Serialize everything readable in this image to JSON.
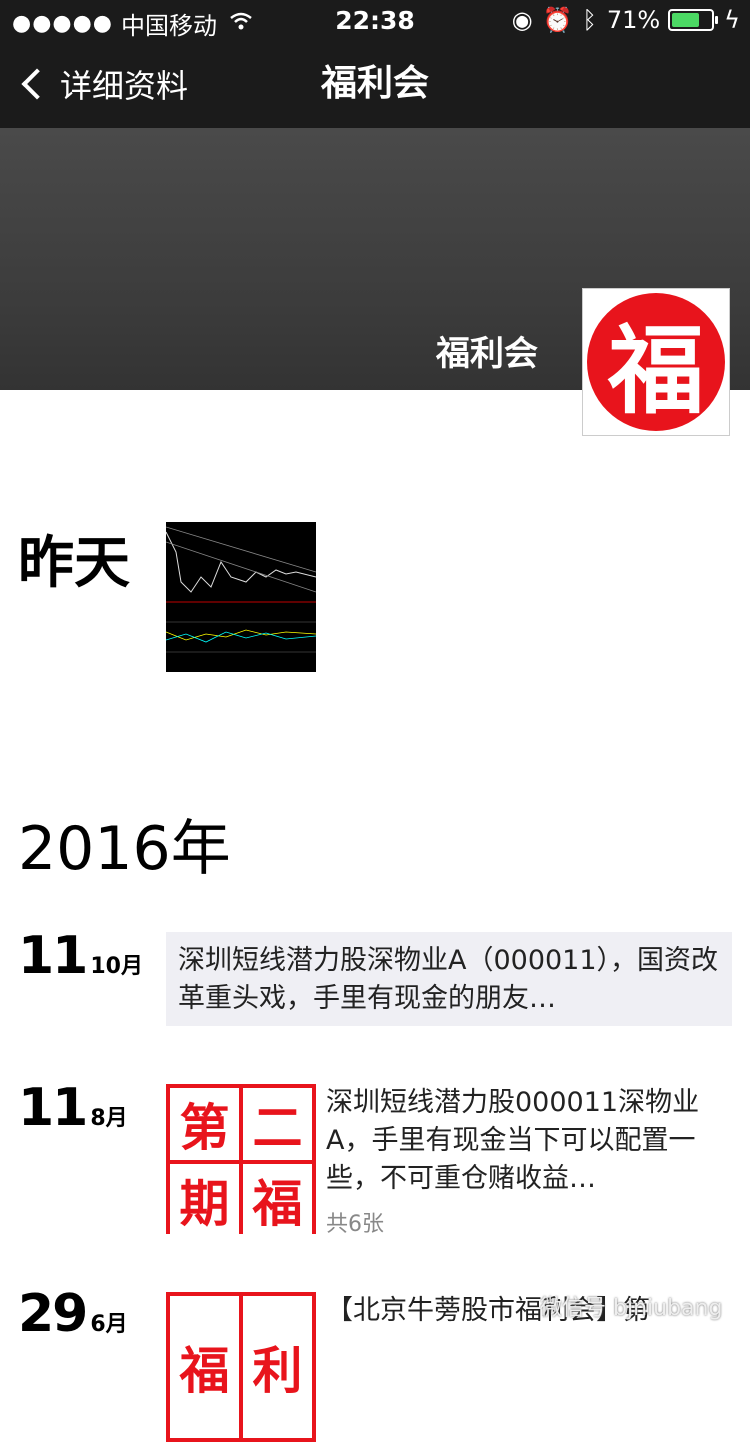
{
  "status_bar": {
    "signal": "●●●●●",
    "carrier": "中国移动",
    "time": "22:38",
    "battery": "71%",
    "battery_level": 0.71
  },
  "nav": {
    "back_label": "详细资料",
    "title": "福利会"
  },
  "profile": {
    "name": "福利会",
    "avatar_char": "福"
  },
  "timeline": {
    "day_label": "昨天",
    "year_label": "2016年",
    "posts": [
      {
        "day": "11",
        "month": "10月",
        "text": "深圳短线潜力股深物业A（000011），国资改革重头戏，手里有现金的朋友…"
      },
      {
        "day": "11",
        "month": "8月",
        "text": "深圳短线潜力股000011深物业A，手里有现金当下可以配置一些，不可重仓赌收益…",
        "count": "共6张",
        "thumb_chars": [
          "第",
          "二",
          "期",
          "福"
        ]
      },
      {
        "day": "29",
        "month": "6月",
        "text": "【北京牛蒡股市福利会】第",
        "thumb_chars": [
          "福",
          "利"
        ]
      }
    ]
  },
  "watermark": "微信号 bjniubang"
}
